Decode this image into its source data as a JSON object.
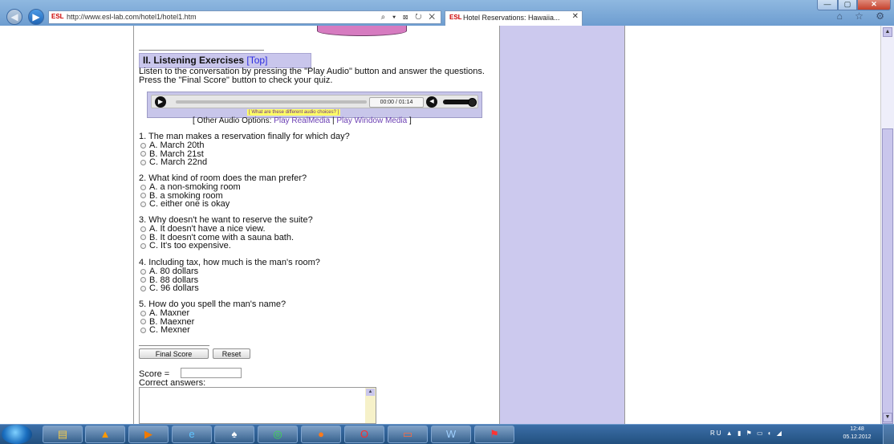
{
  "browser": {
    "favicon": "ESL",
    "url": "http://www.esl-lab.com/hotel1/hotel1.htm",
    "address_controls": "⌕ ▾ ⊠ ↻ ✕",
    "tab_title": "Hotel Reservations: Hawaiia...",
    "tab_close": "✕",
    "right_icons": "⌂ ☆ ⚙",
    "window_controls": [
      "—",
      "▢",
      "✕"
    ]
  },
  "section": {
    "heading": "II. Listening Exercises",
    "top_link": "[Top]",
    "intro": "Listen to the conversation by pressing the \"Play Audio\" button and answer the questions. Press the \"Final Score\" button to check your quiz."
  },
  "player": {
    "time": "00:00 / 01:14",
    "choices_link": "[ What are these different audio choices? ]",
    "progress_fraction": 0,
    "volume_fraction": 0.8,
    "other_prefix": "[ Other Audio Options: ",
    "realmedia": "Play RealMedia",
    "separator": " | ",
    "windowmedia": "Play Window Media",
    "other_suffix": " ]"
  },
  "questions": [
    {
      "text": "1. The man makes a reservation finally for which day?",
      "options": [
        "A. March 20th",
        "B. March 21st",
        "C. March 22nd"
      ]
    },
    {
      "text": "2. What kind of room does the man prefer?",
      "options": [
        "A. a non-smoking room",
        "B. a smoking room",
        "C. either one is okay"
      ]
    },
    {
      "text": "3. Why doesn't he want to reserve the suite?",
      "options": [
        "A. It doesn't have a nice view.",
        "B. It doesn't come with a sauna bath.",
        "C. It's too expensive."
      ]
    },
    {
      "text": "4. Including tax, how much is the man's room?",
      "options": [
        "A. 80 dollars",
        "B. 88 dollars",
        "C. 96 dollars"
      ]
    },
    {
      "text": "5. How do you spell the man's name?",
      "options": [
        "A. Maxner",
        "B. Maexner",
        "C. Mexner"
      ]
    }
  ],
  "buttons": {
    "final_score": "Final Score",
    "reset": "Reset"
  },
  "score": {
    "label": "Score =",
    "value": "",
    "correct_label": "Correct answers:",
    "correct_value": ""
  },
  "taskbar": {
    "apps": [
      "file-explorer-icon",
      "vlc-icon",
      "media-player-icon",
      "internet-explorer-icon",
      "solitaire-icon",
      "chat-icon",
      "firefox-icon",
      "opera-icon",
      "presentation-icon",
      "word-icon",
      "acrobat-icon"
    ],
    "language": "RU",
    "tray_icons": "▲ ▮ ⚑ ▭ ◐ ◢",
    "time": "12:48",
    "date": "05.12.2012"
  },
  "colors": {
    "accent_purple": "#ccc9ee",
    "link": "#2b2be0",
    "choices_bg": "#ffff66"
  }
}
